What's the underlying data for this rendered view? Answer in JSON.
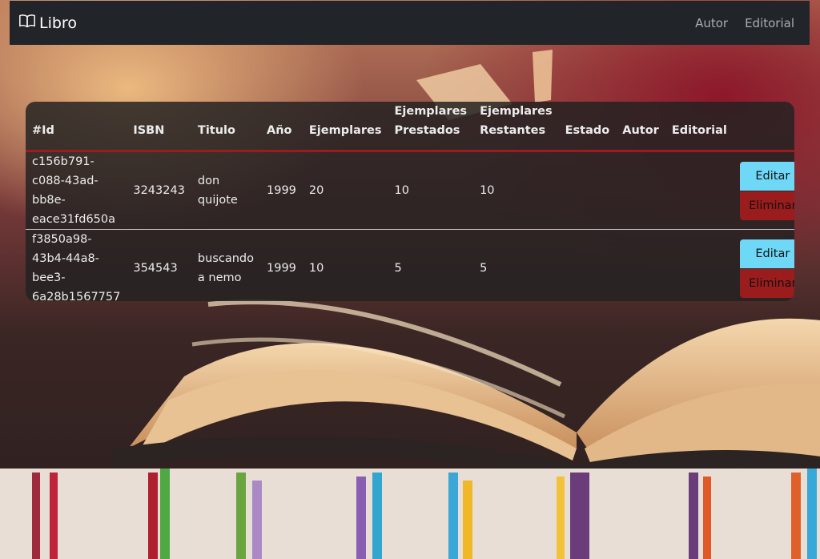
{
  "navbar": {
    "brand": "Libro",
    "brand_icon": "open-book-icon",
    "links": [
      "Autor",
      "Editorial"
    ]
  },
  "table": {
    "headers": [
      "#Id",
      "ISBN",
      "Titulo",
      "Año",
      "Ejemplares",
      "Ejemplares Prestados",
      "Ejemplares Restantes",
      "Estado",
      "Autor",
      "Editorial"
    ],
    "rows": [
      {
        "id": "c156b791-c088-43ad-bb8e-eace31fd650a",
        "isbn": "3243243",
        "titulo": "don quijote",
        "anio": "1999",
        "ejemplares": "20",
        "prestados": "10",
        "restantes": "10",
        "estado": "",
        "autor": "",
        "editorial": ""
      },
      {
        "id": "f3850a98-43b4-44a8-bee3-6a28b1567757",
        "isbn": "354543",
        "titulo": "buscando a nemo",
        "anio": "1999",
        "ejemplares": "10",
        "prestados": "5",
        "restantes": "5",
        "estado": "",
        "autor": "",
        "editorial": ""
      }
    ],
    "edit_label": "Editar",
    "delete_label": "Eliminar"
  },
  "colors": {
    "navbar_bg": "#212529",
    "edit_button": "#6fd8f7",
    "delete_button": "#9b1c1c",
    "header_border": "#9b1c1c"
  }
}
